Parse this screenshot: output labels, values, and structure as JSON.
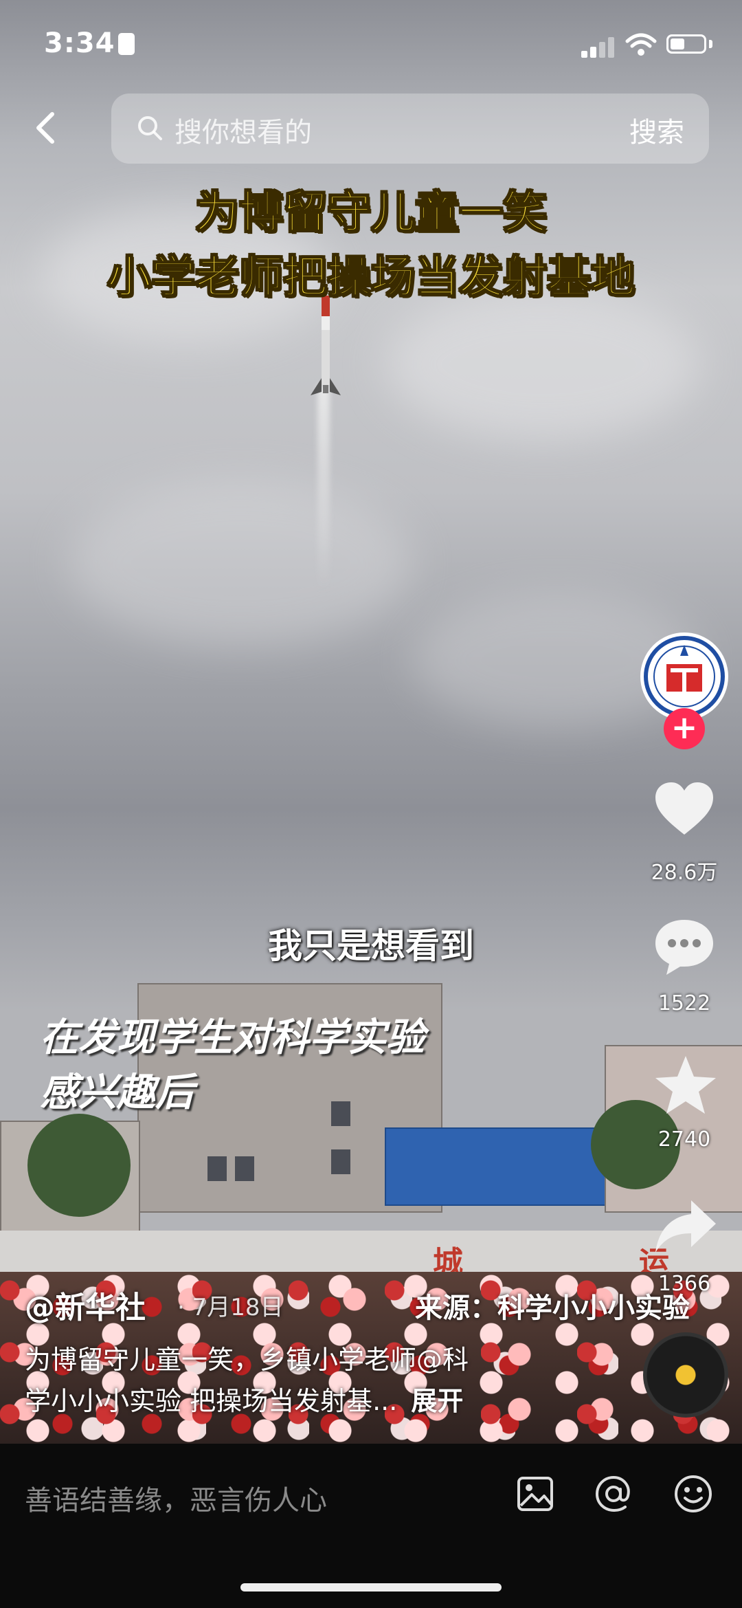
{
  "status_bar": {
    "time": "3:34"
  },
  "search": {
    "placeholder": "搜你想看的",
    "button_label": "搜索"
  },
  "video": {
    "headline_line1": "为博留守儿童一笑",
    "headline_line2": "小学老师把操场当发射基地",
    "subtitle": "我只是想看到",
    "overlay_line1": "在发现学生对科学实验",
    "overlay_line2": "感兴趣后",
    "wall_text_1": "城",
    "wall_text_2": "运"
  },
  "actions": {
    "likes": "28.6万",
    "comments": "1522",
    "favorites": "2740",
    "shares": "1366"
  },
  "post": {
    "author": "@新华社",
    "date": "· 7月18日",
    "source": "来源：科学小小小实验",
    "description_line1": "为博留守儿童一笑，乡镇小学老师@科",
    "description_line2": "学小小小实验 把操场当发射基...",
    "expand_label": "展开"
  },
  "comment_bar": {
    "placeholder": "善语结善缘，恶言伤人心"
  },
  "colors": {
    "headline": "#fde13a",
    "follow": "#fe2c55",
    "accent_disc": "#f1c232"
  }
}
